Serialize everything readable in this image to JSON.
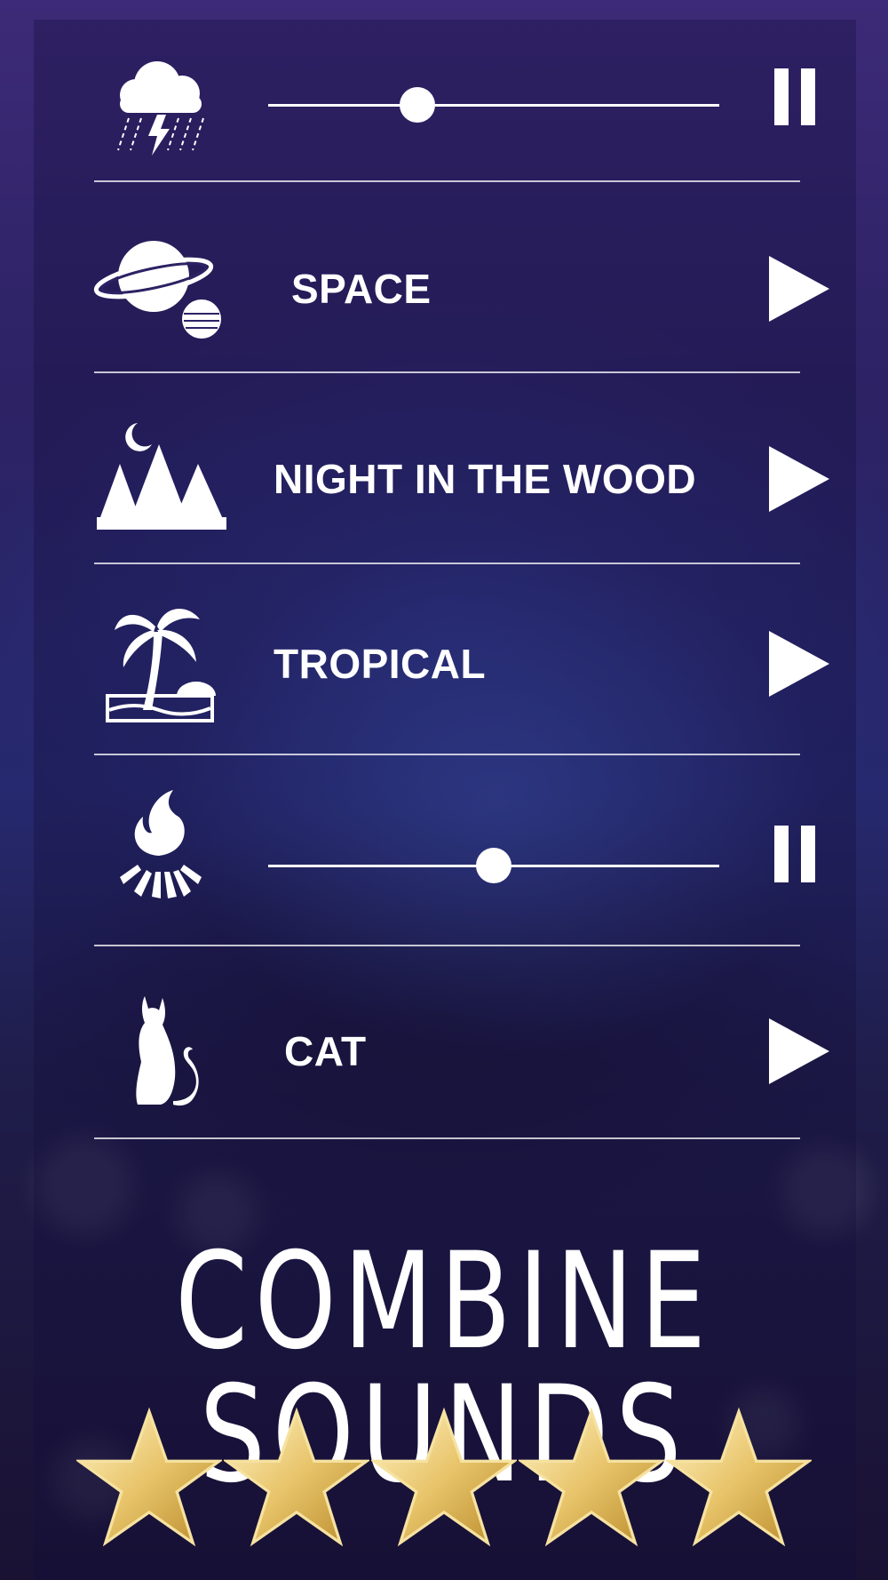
{
  "tracks": [
    {
      "icon": "thunderstorm-icon",
      "label": "",
      "state": "playing",
      "volume": 0.33
    },
    {
      "icon": "planet-icon",
      "label": "SPACE",
      "state": "stopped"
    },
    {
      "icon": "forest-moon-icon",
      "label": "NIGHT IN THE WOOD",
      "state": "stopped"
    },
    {
      "icon": "palm-tree-icon",
      "label": "TROPICAL",
      "state": "stopped"
    },
    {
      "icon": "campfire-icon",
      "label": "",
      "state": "playing",
      "volume": 0.5
    },
    {
      "icon": "cat-icon",
      "label": "CAT",
      "state": "stopped"
    }
  ],
  "headline": "COMBINE SOUNDS",
  "rating": {
    "stars": 5,
    "max": 5
  },
  "colors": {
    "accent": "#ffffff",
    "star_gold": "#e8c46a",
    "background": "#2a1d52"
  }
}
